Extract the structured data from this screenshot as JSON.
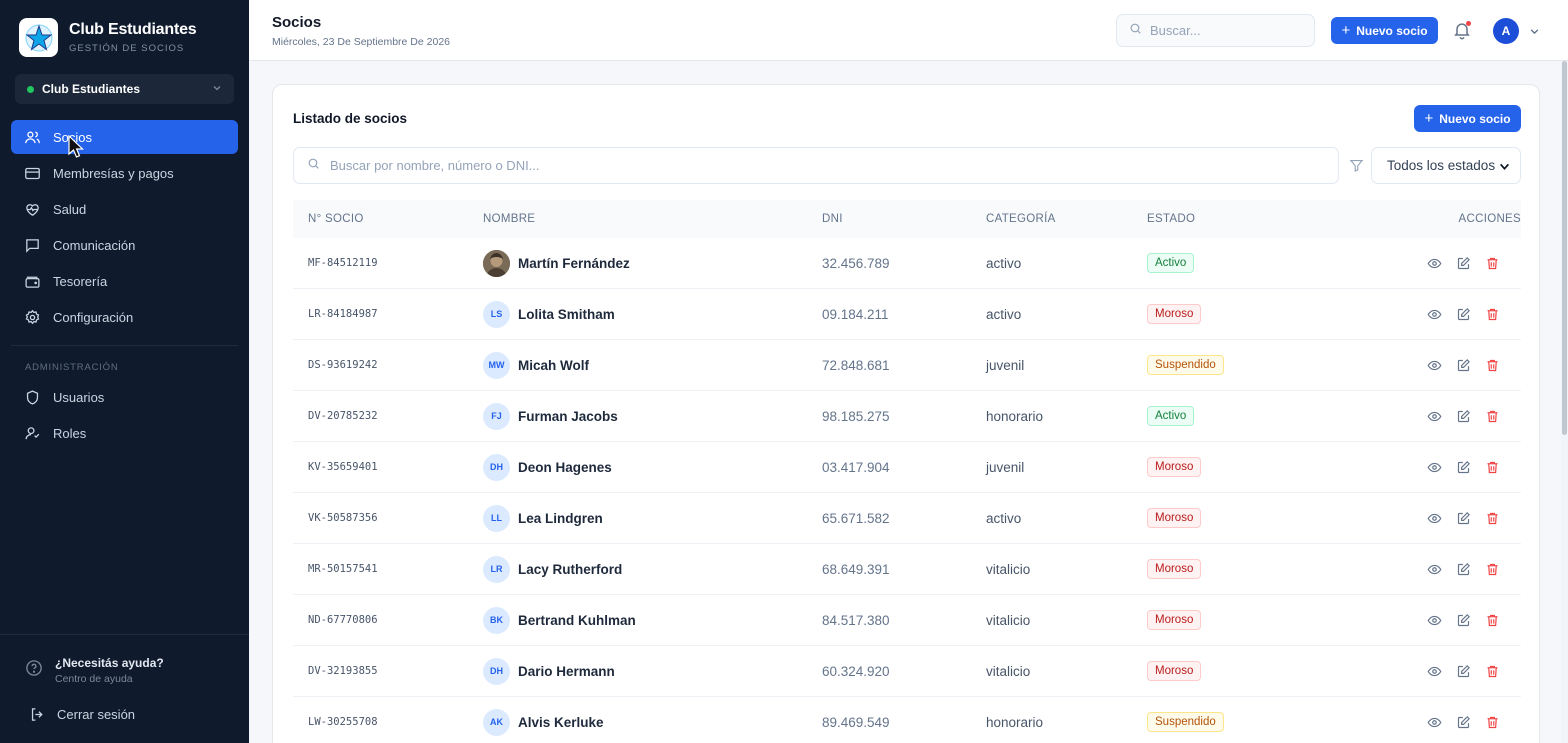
{
  "brand": {
    "title": "Club Estudiantes",
    "subtitle": "GESTIÓN DE SOCIOS"
  },
  "club_selector": {
    "value": "Club Estudiantes",
    "status_color": "#22c55e"
  },
  "nav": {
    "items": [
      {
        "label": "Socios",
        "icon": "users-icon",
        "active": true
      },
      {
        "label": "Membresías y pagos",
        "icon": "credit-card-icon"
      },
      {
        "label": "Salud",
        "icon": "heart-pulse-icon"
      },
      {
        "label": "Comunicación",
        "icon": "message-icon"
      },
      {
        "label": "Tesorería",
        "icon": "wallet-icon"
      },
      {
        "label": "Configuración",
        "icon": "gear-icon"
      }
    ],
    "admin_section": "ADMINISTRACIÓN",
    "admin_items": [
      {
        "label": "Usuarios",
        "icon": "shield-icon"
      },
      {
        "label": "Roles",
        "icon": "user-role-icon"
      }
    ]
  },
  "help": {
    "title": "¿Necesitás ayuda?",
    "subtitle": "Centro de ayuda"
  },
  "logout": {
    "label": "Cerrar sesión"
  },
  "header": {
    "title": "Socios",
    "date": "Miércoles, 23 De Septiembre De 2026",
    "search_placeholder": "Buscar...",
    "new_member_label": "Nuevo socio",
    "avatar_initial": "A"
  },
  "list": {
    "title": "Listado de socios",
    "new_member_label": "Nuevo socio",
    "search_placeholder": "Buscar por nombre, número o DNI...",
    "status_filter": "Todos los estados",
    "columns": [
      "N° SOCIO",
      "NOMBRE",
      "DNI",
      "CATEGORÍA",
      "ESTADO",
      "ACCIONES"
    ],
    "rows": [
      {
        "num": "MF-84512119",
        "initials": "",
        "photo": true,
        "name": "Martín Fernández",
        "dni": "32.456.789",
        "category": "activo",
        "status": "Activo"
      },
      {
        "num": "LR-84184987",
        "initials": "LS",
        "name": "Lolita Smitham",
        "dni": "09.184.211",
        "category": "activo",
        "status": "Moroso"
      },
      {
        "num": "DS-93619242",
        "initials": "MW",
        "name": "Micah Wolf",
        "dni": "72.848.681",
        "category": "juvenil",
        "status": "Suspendido"
      },
      {
        "num": "DV-20785232",
        "initials": "FJ",
        "name": "Furman Jacobs",
        "dni": "98.185.275",
        "category": "honorario",
        "status": "Activo"
      },
      {
        "num": "KV-35659401",
        "initials": "DH",
        "name": "Deon Hagenes",
        "dni": "03.417.904",
        "category": "juvenil",
        "status": "Moroso"
      },
      {
        "num": "VK-50587356",
        "initials": "LL",
        "name": "Lea Lindgren",
        "dni": "65.671.582",
        "category": "activo",
        "status": "Moroso"
      },
      {
        "num": "MR-50157541",
        "initials": "LR",
        "name": "Lacy Rutherford",
        "dni": "68.649.391",
        "category": "vitalicio",
        "status": "Moroso"
      },
      {
        "num": "ND-67770806",
        "initials": "BK",
        "name": "Bertrand Kuhlman",
        "dni": "84.517.380",
        "category": "vitalicio",
        "status": "Moroso"
      },
      {
        "num": "DV-32193855",
        "initials": "DH",
        "name": "Dario Hermann",
        "dni": "60.324.920",
        "category": "vitalicio",
        "status": "Moroso"
      },
      {
        "num": "LW-30255708",
        "initials": "AK",
        "name": "Alvis Kerluke",
        "dni": "89.469.549",
        "category": "honorario",
        "status": "Suspendido"
      }
    ]
  },
  "colors": {
    "accent": "#2563eb",
    "sidebar_bg": "#0f1b2d",
    "activo": "#15803d",
    "moroso": "#b91c1c",
    "suspendido": "#b45309"
  }
}
